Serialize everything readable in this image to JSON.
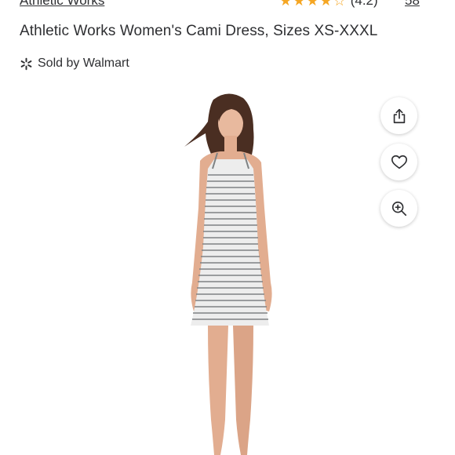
{
  "brand": {
    "label": "Athletic Works"
  },
  "rating": {
    "value": 4,
    "max": 5,
    "text": "(4.2)",
    "reviews": "58",
    "star_color": "#f5a623"
  },
  "product": {
    "title": "Athletic Works Women's Cami Dress, Sizes XS-XXXL"
  },
  "seller": {
    "label": "Sold by Walmart",
    "icon": "walmart-spark-icon"
  },
  "actions": [
    {
      "name": "share-button",
      "icon": "share-icon"
    },
    {
      "name": "favorite-button",
      "icon": "heart-icon"
    },
    {
      "name": "zoom-button",
      "icon": "zoom-in-icon"
    }
  ]
}
